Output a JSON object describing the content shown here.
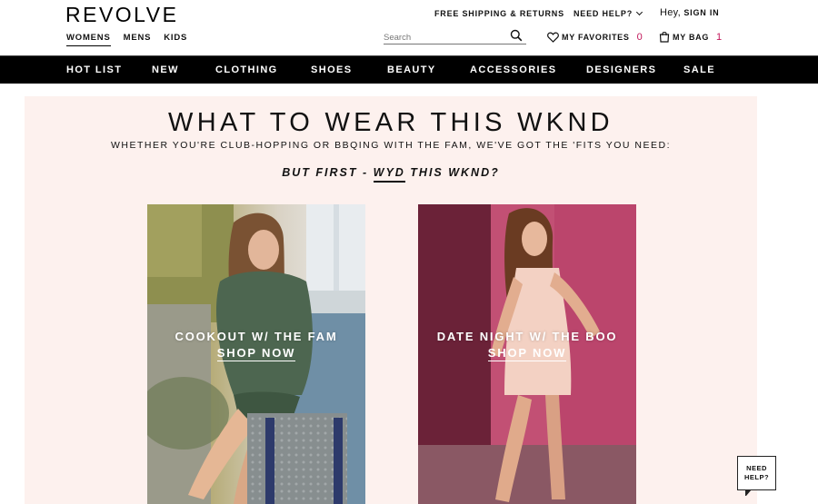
{
  "header": {
    "logo": "REVOLVE",
    "gender_tabs": [
      {
        "label": "WOMENS",
        "active": true
      },
      {
        "label": "MENS",
        "active": false
      },
      {
        "label": "KIDS",
        "active": false
      }
    ],
    "free_shipping": "FREE SHIPPING & RETURNS",
    "need_help": "NEED HELP?",
    "greeting": "Hey,",
    "sign_in": "SIGN IN",
    "search_placeholder": "Search",
    "favorites_label": "MY FAVORITES",
    "favorites_count": "0",
    "bag_label": "MY BAG",
    "bag_count": "1"
  },
  "main_nav": [
    "HOT LIST",
    "NEW",
    "CLOTHING",
    "SHOES",
    "BEAUTY",
    "ACCESSORIES",
    "DESIGNERS",
    "SALE"
  ],
  "hero": {
    "title": "WHAT TO WEAR THIS WKND",
    "subtitle": "WHETHER YOU'RE CLUB-HOPPING OR BBQING WITH THE FAM, WE'VE GOT THE 'FITS YOU NEED:",
    "question_prefix": "BUT FIRST - ",
    "question_underlined": "WYD",
    "question_suffix": " THIS WKND?"
  },
  "cards": [
    {
      "label": "COOKOUT W/ THE FAM",
      "cta": "SHOP NOW"
    },
    {
      "label": "DATE NIGHT W/ THE BOO",
      "cta": "SHOP NOW"
    }
  ],
  "chat_widget": {
    "line1": "NEED",
    "line2": "HELP?"
  },
  "colors": {
    "accent_count": "#c2185b",
    "nav_bg": "#000000",
    "hero_bg": "#fdf1ee"
  }
}
